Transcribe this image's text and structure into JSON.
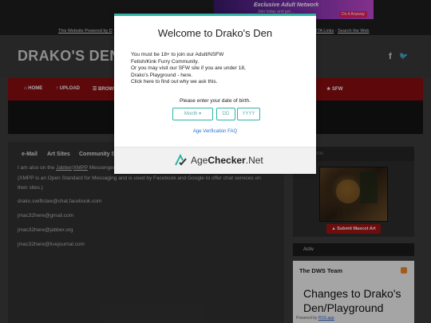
{
  "ad": {
    "title": "Exclusive Adult Network",
    "subtitle": "Join today and get…",
    "button": "Do it Anyway"
  },
  "top": {
    "powered_left": "This Website Powered by D",
    "powered_right_a": "ITA Links",
    "powered_sep": " · ",
    "powered_right_b": "Search the Web"
  },
  "site": {
    "logo": "DRAKO'S DEN",
    "social": {
      "facebook": "f",
      "twitter": "🐦"
    }
  },
  "nav": {
    "items": [
      "⌂ HOME",
      "↑ UPLOAD",
      "☰ BROWS",
      "★ SFW"
    ]
  },
  "tabs": [
    "e-Mail",
    "Art Sites",
    "Community S"
  ],
  "content": {
    "line1_pre": "I am also on the ",
    "line1_link1": "Jabber",
    "line1_slash": "/",
    "line1_link2": "XMPP",
    "line1_post": " Messenger",
    "line2": "(XMPP is an Open Standard for Messaging and is used by Facebook and Google to offer chat services on",
    "line3": "their sites.)",
    "contacts": [
      "drako.swiftclaw@chat.facebook.com",
      "jmac32here@gmail.com",
      "jmac32here@jabber.org",
      "jmac32here@livejournal.com"
    ]
  },
  "sidebar": {
    "header_faint": "tron",
    "submit_mascot": "▲ Submit Mascot Art",
    "news_header": "Activ",
    "news_team": "The DWS Team",
    "news_headline": "Changes to Drako's Den/Playground",
    "powered_by": "Powered by ",
    "rss_app": "RSS.app"
  },
  "modal": {
    "title": "Welcome to Drako's Den",
    "body_lines": [
      "You must be 18+ to join our Adult/NSFW",
      "Fetish/Kink Furry Community.",
      "Or you may visit our SFW site if you are under 18,",
      "Drako's Playground - here.",
      "Click here to find out why we ask this."
    ],
    "dob_label": "Please enter your date of birth.",
    "month_placeholder": "Month",
    "day_placeholder": "DD",
    "year_placeholder": "YYYY",
    "verification_faq": "Age Verification FAQ",
    "brand_a": "Age",
    "brand_b": "Checker",
    "brand_c": ".Net"
  },
  "colors": {
    "accent": "#2fb3a6",
    "nav_red": "#8b0d10",
    "mascot_red": "#a31515"
  }
}
